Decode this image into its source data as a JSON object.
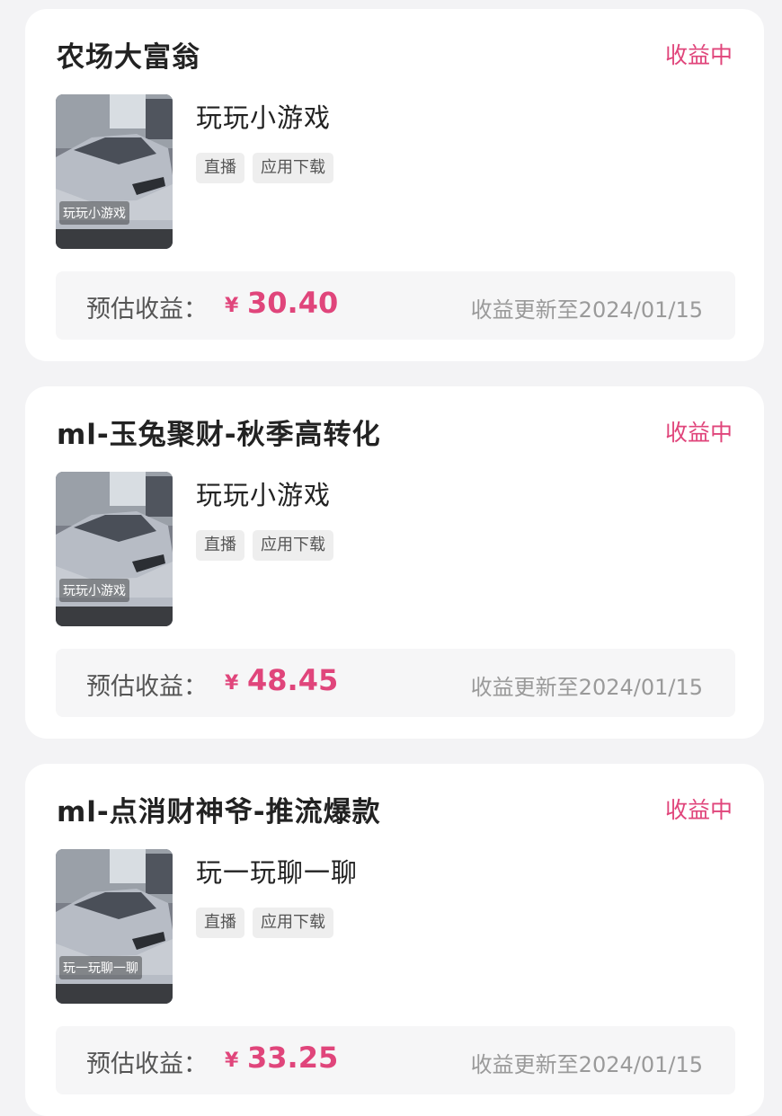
{
  "cards": [
    {
      "title": "农场大富翁",
      "status": "收益中",
      "thumbnail_caption": "玩玩小游戏",
      "game_name": "玩玩小游戏",
      "tags": [
        "直播",
        "应用下载"
      ],
      "earnings_label": "预估收益：",
      "currency": "¥",
      "earnings_value": "30.40",
      "update_text": "收益更新至2024/01/15"
    },
    {
      "title": "ml-玉兔聚财-秋季高转化",
      "status": "收益中",
      "thumbnail_caption": "玩玩小游戏",
      "game_name": "玩玩小游戏",
      "tags": [
        "直播",
        "应用下载"
      ],
      "earnings_label": "预估收益：",
      "currency": "¥",
      "earnings_value": "48.45",
      "update_text": "收益更新至2024/01/15"
    },
    {
      "title": "ml-点消财神爷-推流爆款",
      "status": "收益中",
      "thumbnail_caption": "玩一玩聊一聊",
      "game_name": "玩一玩聊一聊",
      "tags": [
        "直播",
        "应用下载"
      ],
      "earnings_label": "预估收益：",
      "currency": "¥",
      "earnings_value": "33.25",
      "update_text": "收益更新至2024/01/15"
    }
  ],
  "colors": {
    "accent": "#e0457b",
    "background": "#f3f3f5",
    "card": "#ffffff"
  }
}
